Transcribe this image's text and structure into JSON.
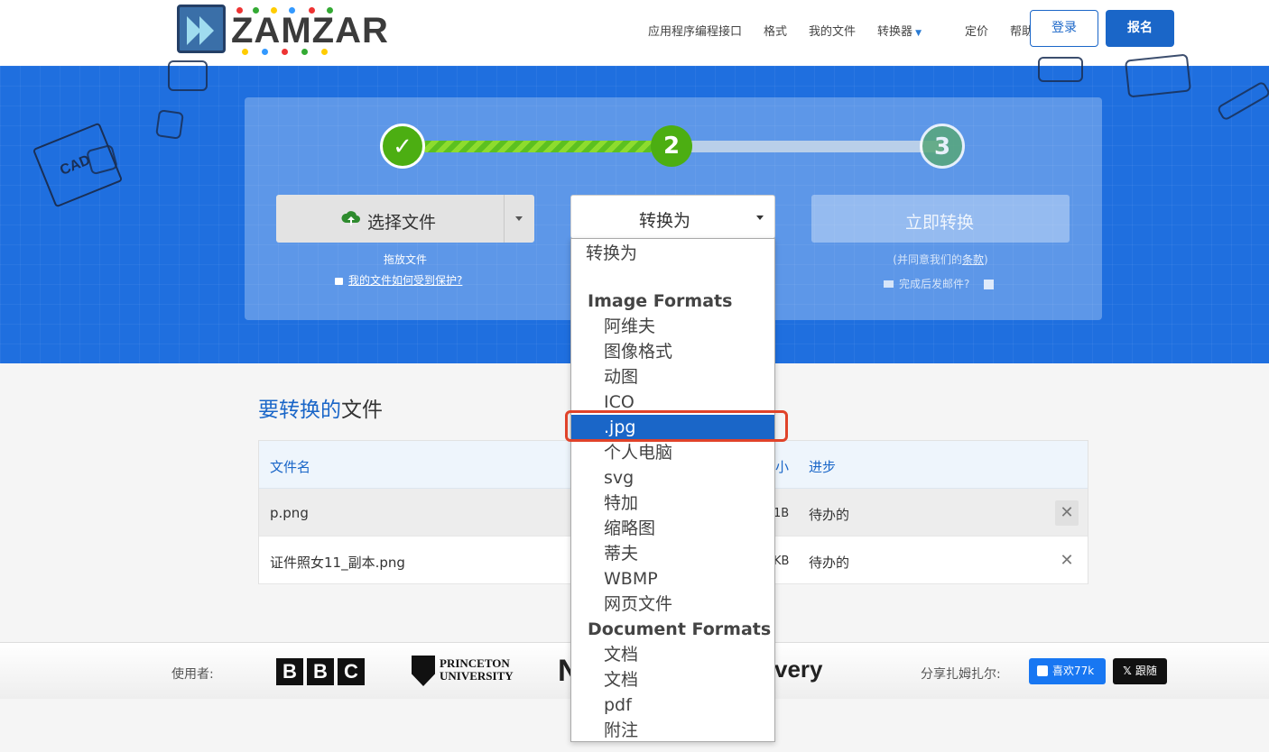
{
  "nav": {
    "brand": "ZAMZAR",
    "tm": "™",
    "links": [
      "应用程序编程接口",
      "格式",
      "我的文件",
      "转换器",
      "定价",
      "帮助"
    ],
    "login": "登录",
    "signup": "报名"
  },
  "hero": {
    "cad_label": "CAD",
    "steps": [
      "✓",
      "2",
      "3"
    ],
    "choose_files": "选择文件",
    "drop_files": "拖放文件",
    "secure_link": "我的文件如何受到保护?",
    "convert_to": "转换为",
    "convert_now": "立即转换",
    "agree_prefix": "(并同意我们的",
    "agree_terms": "条款",
    "agree_suffix": ")",
    "email_when_done": "完成后发邮件?"
  },
  "dropdown": {
    "placeholder": "转换为",
    "group1": "Image Formats",
    "image_items": [
      "阿维夫",
      "图像格式",
      "动图",
      "ICO",
      ".jpg",
      "个人电脑",
      "svg",
      "特加",
      "缩略图",
      "蒂夫",
      "WBMP",
      "网页文件"
    ],
    "group2": "Document Formats",
    "doc_items": [
      "文档",
      "文档",
      "pdf",
      "附注"
    ],
    "selected": ".jpg"
  },
  "files": {
    "title_a": "要转换的",
    "title_b": "文件",
    "headers": {
      "name": "文件名",
      "size_tail": "小",
      "progress": "进步"
    },
    "rows": [
      {
        "name": "p.png",
        "size_tail": "1B",
        "status": "待办的"
      },
      {
        "name": "证件照女11_副本.png",
        "size_tail": "KB",
        "status": "待办的"
      }
    ],
    "remove": "✕"
  },
  "footer": {
    "used_by": "使用者:",
    "bbc": [
      "B",
      "B",
      "C"
    ],
    "princeton_1": "PRINCETON",
    "princeton_2": "UNIVERSITY",
    "logo_m": "N",
    "logo_very": "very",
    "share": "分享扎姆扎尔:",
    "fb_like": "喜欢77k",
    "x_follow": "跟随"
  }
}
